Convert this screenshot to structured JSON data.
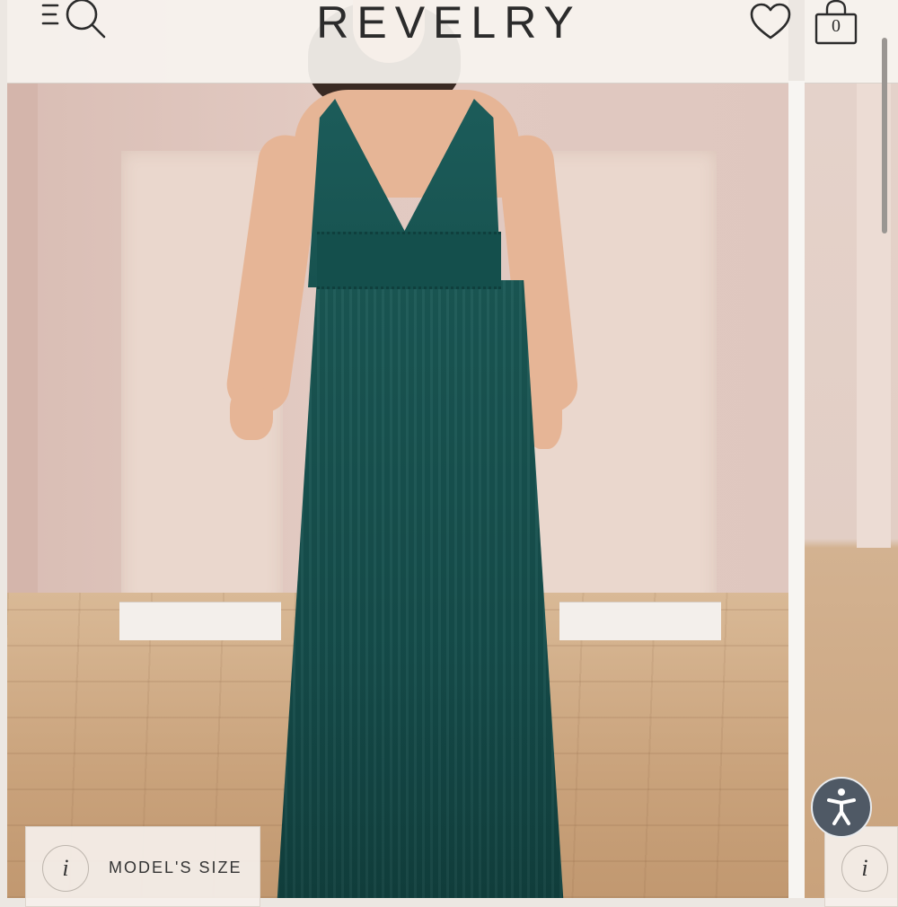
{
  "header": {
    "brand": "REVELRY",
    "cart_count": "0",
    "icons": [
      "menu-icon",
      "search-icon",
      "heart-icon",
      "shopping-bag-icon"
    ]
  },
  "gallery": {
    "image_subject": "model in teal tulle maxi dress",
    "size_chip": {
      "info_symbol": "i",
      "label": "MODEL'S SIZE"
    },
    "next_size_chip": {
      "info_symbol": "i"
    }
  },
  "accessibility": {
    "icon": "accessibility-icon"
  },
  "colors": {
    "header_bg": "#f7f4f0",
    "dress": "#17524f",
    "a11y_button": "#4f5965",
    "text": "#2b2b2b"
  }
}
